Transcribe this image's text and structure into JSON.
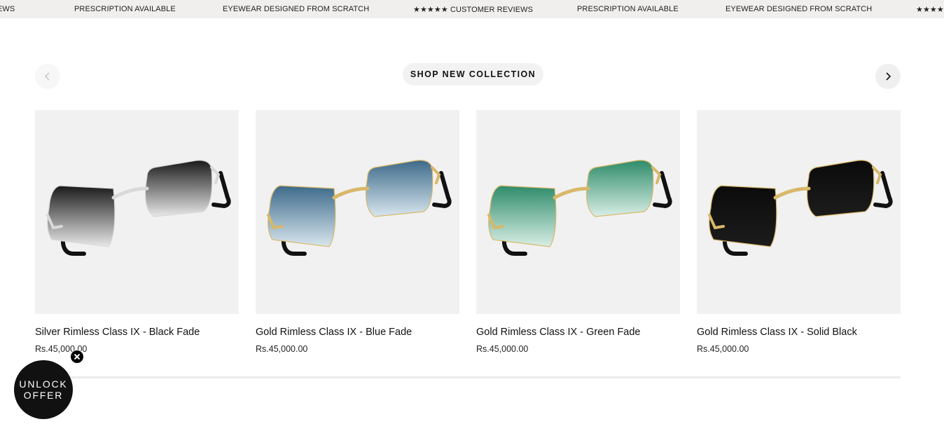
{
  "marquee": {
    "items": [
      "EWS",
      "PRESCRIPTION AVAILABLE",
      "EYEWEAR DESIGNED FROM SCRATCH",
      "★★★★★ CUSTOMER REVIEWS",
      "PRESCRIPTION AVAILABLE",
      "EYEWEAR DESIGNED FROM SCRATCH",
      "★★★★★"
    ]
  },
  "section": {
    "title": "SHOP NEW COLLECTION"
  },
  "products": [
    {
      "name": "Silver Rimless Class IX - Black Fade",
      "price": "Rs.45,000.00",
      "lens_color": "#1a1a1a",
      "lens_fade": "#e8e8e8",
      "frame_color": "#d9d9d9"
    },
    {
      "name": "Gold Rimless Class IX - Blue Fade",
      "price": "Rs.45,000.00",
      "lens_color": "#3d6a8a",
      "lens_fade": "#d8e6ee",
      "frame_color": "#d8b86a"
    },
    {
      "name": "Gold Rimless Class IX - Green Fade",
      "price": "Rs.45,000.00",
      "lens_color": "#2e8c6a",
      "lens_fade": "#d9eee6",
      "frame_color": "#d8b86a"
    },
    {
      "name": "Gold Rimless Class IX - Solid Black",
      "price": "Rs.45,000.00",
      "lens_color": "#0b0b0b",
      "lens_fade": "#1c1c1c",
      "frame_color": "#d8b86a"
    }
  ],
  "carousel": {
    "prev_icon": "chevron-left-icon",
    "next_icon": "chevron-right-icon",
    "progress": 0.25
  },
  "popup": {
    "line1": "UNLOCK",
    "line2": "OFFER",
    "close_icon": "close-icon"
  }
}
